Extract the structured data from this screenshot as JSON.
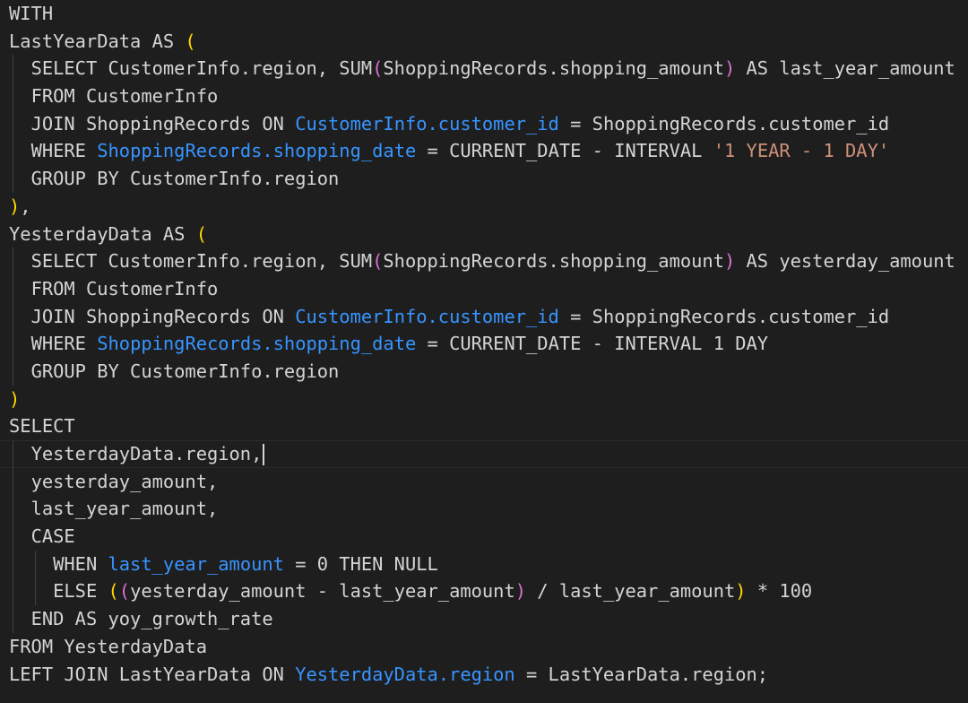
{
  "editor": {
    "language": "sql",
    "colors": {
      "background": "#1e1e1e",
      "text": "#d4d4d4",
      "bracket_level_1": "#ffd700",
      "bracket_level_2": "#da70d6",
      "identifier_highlight": "#3794ff",
      "string": "#ce9178"
    },
    "cursor_line": 17,
    "lines": [
      {
        "indent": 0,
        "tokens": [
          {
            "t": "WITH",
            "k": "kw"
          }
        ]
      },
      {
        "indent": 0,
        "tokens": [
          {
            "t": "LastYearData AS ",
            "k": "id"
          },
          {
            "t": "(",
            "k": "p1"
          }
        ]
      },
      {
        "indent": 1,
        "tokens": [
          {
            "t": "SELECT CustomerInfo.region, SUM",
            "k": "id"
          },
          {
            "t": "(",
            "k": "p2"
          },
          {
            "t": "ShoppingRecords.shopping_amount",
            "k": "id"
          },
          {
            "t": ")",
            "k": "p2"
          },
          {
            "t": " AS last_year_amount",
            "k": "id"
          }
        ]
      },
      {
        "indent": 1,
        "tokens": [
          {
            "t": "FROM CustomerInfo",
            "k": "id"
          }
        ]
      },
      {
        "indent": 1,
        "tokens": [
          {
            "t": "JOIN ShoppingRecords ON ",
            "k": "id"
          },
          {
            "t": "CustomerInfo.customer_id",
            "k": "link"
          },
          {
            "t": " = ShoppingRecords.customer_id",
            "k": "id"
          }
        ]
      },
      {
        "indent": 1,
        "tokens": [
          {
            "t": "WHERE ",
            "k": "id"
          },
          {
            "t": "ShoppingRecords.shopping_date",
            "k": "link"
          },
          {
            "t": " = CURRENT_DATE - INTERVAL ",
            "k": "id"
          },
          {
            "t": "'1 YEAR - 1 DAY'",
            "k": "str"
          }
        ]
      },
      {
        "indent": 1,
        "tokens": [
          {
            "t": "GROUP BY CustomerInfo.region",
            "k": "id"
          }
        ]
      },
      {
        "indent": 0,
        "tokens": [
          {
            "t": ")",
            "k": "p1"
          },
          {
            "t": ",",
            "k": "id"
          }
        ]
      },
      {
        "indent": 0,
        "tokens": [
          {
            "t": "YesterdayData AS ",
            "k": "id"
          },
          {
            "t": "(",
            "k": "p1"
          }
        ]
      },
      {
        "indent": 1,
        "tokens": [
          {
            "t": "SELECT CustomerInfo.region, SUM",
            "k": "id"
          },
          {
            "t": "(",
            "k": "p2"
          },
          {
            "t": "ShoppingRecords.shopping_amount",
            "k": "id"
          },
          {
            "t": ")",
            "k": "p2"
          },
          {
            "t": " AS yesterday_amount",
            "k": "id"
          }
        ]
      },
      {
        "indent": 1,
        "tokens": [
          {
            "t": "FROM CustomerInfo",
            "k": "id"
          }
        ]
      },
      {
        "indent": 1,
        "tokens": [
          {
            "t": "JOIN ShoppingRecords ON ",
            "k": "id"
          },
          {
            "t": "CustomerInfo.customer_id",
            "k": "link"
          },
          {
            "t": " = ShoppingRecords.customer_id",
            "k": "id"
          }
        ]
      },
      {
        "indent": 1,
        "tokens": [
          {
            "t": "WHERE ",
            "k": "id"
          },
          {
            "t": "ShoppingRecords.shopping_date",
            "k": "link"
          },
          {
            "t": " = CURRENT_DATE - INTERVAL 1 DAY",
            "k": "id"
          }
        ]
      },
      {
        "indent": 1,
        "tokens": [
          {
            "t": "GROUP BY CustomerInfo.region",
            "k": "id"
          }
        ]
      },
      {
        "indent": 0,
        "tokens": [
          {
            "t": ")",
            "k": "p1"
          }
        ]
      },
      {
        "indent": 0,
        "tokens": [
          {
            "t": "SELECT",
            "k": "id"
          }
        ]
      },
      {
        "indent": 1,
        "tokens": [
          {
            "t": "YesterdayData.region,",
            "k": "id"
          }
        ]
      },
      {
        "indent": 1,
        "tokens": [
          {
            "t": "yesterday_amount,",
            "k": "id"
          }
        ]
      },
      {
        "indent": 1,
        "tokens": [
          {
            "t": "last_year_amount,",
            "k": "id"
          }
        ]
      },
      {
        "indent": 1,
        "tokens": [
          {
            "t": "CASE",
            "k": "id"
          }
        ]
      },
      {
        "indent": 2,
        "tokens": [
          {
            "t": "WHEN ",
            "k": "id"
          },
          {
            "t": "last_year_amount",
            "k": "link"
          },
          {
            "t": " = 0 THEN NULL",
            "k": "id"
          }
        ]
      },
      {
        "indent": 2,
        "tokens": [
          {
            "t": "ELSE ",
            "k": "id"
          },
          {
            "t": "(",
            "k": "p1"
          },
          {
            "t": "(",
            "k": "p2"
          },
          {
            "t": "yesterday_amount - last_year_amount",
            "k": "id"
          },
          {
            "t": ")",
            "k": "p2"
          },
          {
            "t": " / last_year_amount",
            "k": "id"
          },
          {
            "t": ")",
            "k": "p1"
          },
          {
            "t": " * 100",
            "k": "id"
          }
        ]
      },
      {
        "indent": 1,
        "tokens": [
          {
            "t": "END AS yoy_growth_rate",
            "k": "id"
          }
        ]
      },
      {
        "indent": 0,
        "tokens": [
          {
            "t": "FROM YesterdayData",
            "k": "id"
          }
        ]
      },
      {
        "indent": 0,
        "tokens": [
          {
            "t": "LEFT JOIN LastYearData ON ",
            "k": "id"
          },
          {
            "t": "YesterdayData.region",
            "k": "link"
          },
          {
            "t": " = LastYearData.region;",
            "k": "id"
          }
        ]
      }
    ]
  }
}
